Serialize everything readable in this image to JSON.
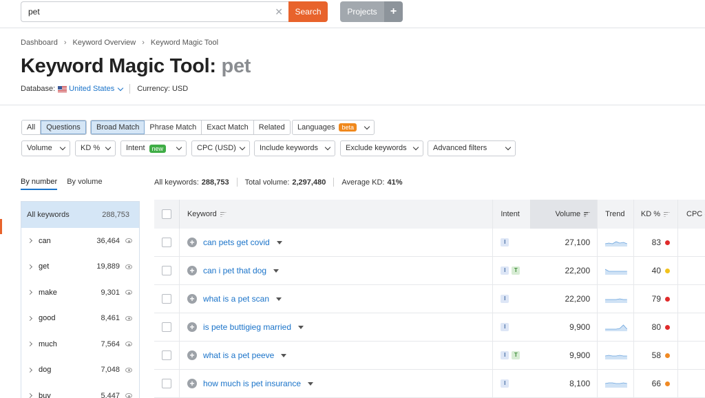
{
  "search": {
    "value": "pet",
    "clear_icon": "close-icon",
    "button_label": "Search"
  },
  "projects": {
    "label": "Projects",
    "plus": "+"
  },
  "breadcrumb": [
    "Dashboard",
    "Keyword Overview",
    "Keyword Magic Tool"
  ],
  "page": {
    "title": "Keyword Magic Tool:",
    "keyword": "pet"
  },
  "database": {
    "label": "Database:",
    "country": "United States",
    "currency": "Currency: USD"
  },
  "filters": {
    "group1": [
      {
        "label": "All",
        "active": false
      },
      {
        "label": "Questions",
        "active": true
      }
    ],
    "group2": [
      {
        "label": "Broad Match",
        "active": true
      },
      {
        "label": "Phrase Match",
        "active": false
      },
      {
        "label": "Exact Match",
        "active": false
      },
      {
        "label": "Related",
        "active": false
      }
    ],
    "languages": {
      "label": "Languages",
      "badge": "beta"
    },
    "volume": "Volume",
    "kd": "KD %",
    "intent": {
      "label": "Intent",
      "badge": "new"
    },
    "cpc": "CPC (USD)",
    "include": "Include keywords",
    "exclude": "Exclude keywords",
    "advanced": "Advanced filters"
  },
  "sidebar": {
    "tab_by_number": "By number",
    "tab_by_volume": "By volume",
    "all": {
      "label": "All keywords",
      "count": "288,753"
    },
    "items": [
      {
        "label": "can",
        "count": "36,464"
      },
      {
        "label": "get",
        "count": "19,889"
      },
      {
        "label": "make",
        "count": "9,301"
      },
      {
        "label": "good",
        "count": "8,461"
      },
      {
        "label": "much",
        "count": "7,564"
      },
      {
        "label": "dog",
        "count": "7,048"
      },
      {
        "label": "buy",
        "count": "5,447"
      }
    ]
  },
  "stats": {
    "all_label": "All keywords:",
    "all_value": "288,753",
    "volume_label": "Total volume:",
    "volume_value": "2,297,480",
    "kd_label": "Average KD:",
    "kd_value": "41%"
  },
  "table": {
    "headers": {
      "keyword": "Keyword",
      "intent": "Intent",
      "volume": "Volume",
      "trend": "Trend",
      "kd": "KD %",
      "cpc": "CPC ("
    },
    "rows": [
      {
        "keyword": "can pets get covid",
        "intent": [
          "I"
        ],
        "volume": "27,100",
        "kd": "83",
        "kd_color": "#e02b2b",
        "trend": [
          6,
          5,
          6,
          3,
          5,
          4,
          6
        ]
      },
      {
        "keyword": "can i pet that dog",
        "intent": [
          "I",
          "T"
        ],
        "volume": "22,200",
        "kd": "40",
        "kd_color": "#f2c21b",
        "trend": [
          2,
          5,
          5,
          5,
          5,
          5,
          5
        ]
      },
      {
        "keyword": "what is a pet scan",
        "intent": [
          "I"
        ],
        "volume": "22,200",
        "kd": "79",
        "kd_color": "#e02b2b",
        "trend": [
          5,
          5,
          5,
          5,
          4,
          5,
          5
        ]
      },
      {
        "keyword": "is pete buttigieg married",
        "intent": [
          "I"
        ],
        "volume": "9,900",
        "kd": "80",
        "kd_color": "#e02b2b",
        "trend": [
          7,
          7,
          7,
          7,
          6,
          1,
          7
        ]
      },
      {
        "keyword": "what is a pet peeve",
        "intent": [
          "I",
          "T"
        ],
        "volume": "9,900",
        "kd": "58",
        "kd_color": "#f08a24",
        "trend": [
          5,
          4,
          5,
          5,
          4,
          5,
          5
        ]
      },
      {
        "keyword": "how much is pet insurance",
        "intent": [
          "I"
        ],
        "volume": "8,100",
        "kd": "66",
        "kd_color": "#f08a24",
        "trend": [
          4,
          3,
          3,
          4,
          4,
          3,
          4
        ]
      }
    ]
  }
}
